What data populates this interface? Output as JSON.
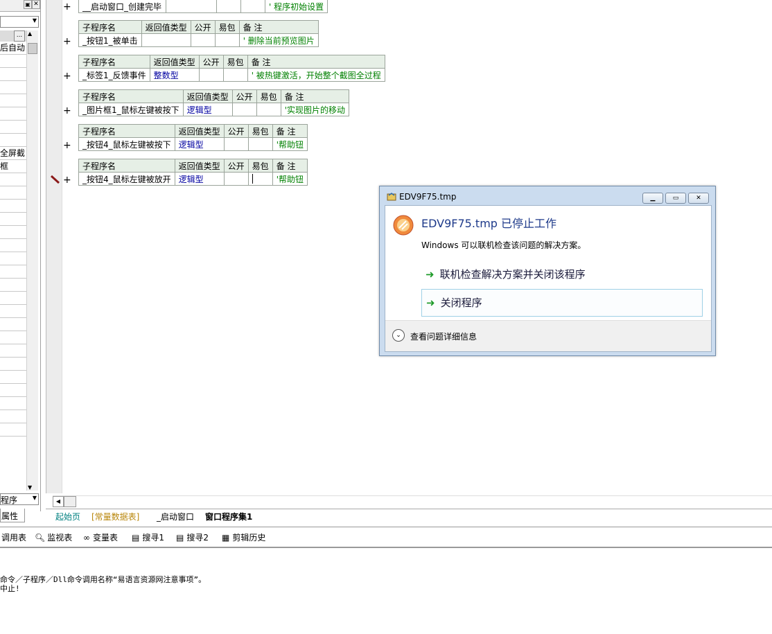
{
  "left_panel": {
    "partial_text_1": "后自动",
    "partial_text_2": "全屏截",
    "partial_text_3": "框",
    "bottom_dropdown": "程序",
    "properties_tab": "属性",
    "ellipsis": "..."
  },
  "code_tables": [
    {
      "name": "__启动窗口_创建完毕",
      "type": "",
      "public": "",
      "package": "",
      "remark": "' 程序初始设置",
      "header_visible": false
    },
    {
      "name": "_按钮1_被单击",
      "type": "",
      "public": "",
      "package": "",
      "remark": "' 删除当前预览图片",
      "header_visible": true
    },
    {
      "name": "_标签1_反馈事件",
      "type": "整数型",
      "public": "",
      "package": "",
      "remark": "' 被热键激活，开始整个截图全过程",
      "header_visible": true
    },
    {
      "name": "_图片框1_鼠标左键被按下",
      "type": "逻辑型",
      "public": "",
      "package": "",
      "remark": "'实现图片的移动",
      "header_visible": true
    },
    {
      "name": "_按钮4_鼠标左键被按下",
      "type": "逻辑型",
      "public": "",
      "package": "",
      "remark": "'帮助钮",
      "header_visible": true
    },
    {
      "name": "_按钮4_鼠标左键被放开",
      "type": "逻辑型",
      "public": "",
      "package": "",
      "remark": "'帮助钮",
      "header_visible": true
    }
  ],
  "table_headers": {
    "name": "子程序名",
    "type": "返回值类型",
    "public": "公开",
    "package": "易包",
    "remark": "备 注"
  },
  "plus_symbol": "+",
  "tabs": [
    {
      "label": "起始页",
      "color": "#008080"
    },
    {
      "label": "[常量数据表]",
      "color": "#b8860b"
    },
    {
      "label": "_启动窗口",
      "color": "#000000"
    },
    {
      "label": "窗口程序集1",
      "color": "#000000",
      "active": true
    }
  ],
  "bottom_toolbar": [
    {
      "label": "调用表",
      "icon": "list-icon"
    },
    {
      "label": "监视表",
      "icon": "magnifier-icon"
    },
    {
      "label": "变量表",
      "icon": "variables-icon"
    },
    {
      "label": "搜寻1",
      "icon": "search-doc-icon"
    },
    {
      "label": "搜寻2",
      "icon": "search-doc-icon"
    },
    {
      "label": "剪辑历史",
      "icon": "clipboard-icon"
    }
  ],
  "output_lines": [
    "命令／子程序／Dll命令调用名称“易语言资源网注意事项”。",
    "中止!"
  ],
  "dialog": {
    "title": "EDV9F75.tmp",
    "heading": "EDV9F75.tmp 已停止工作",
    "message": "Windows 可以联机检查该问题的解决方案。",
    "option_check": "联机检查解决方案并关闭该程序",
    "option_close": "关闭程序",
    "details": "查看问题详细信息"
  },
  "colors": {
    "accent_green": "#1f9b2a",
    "header_bg": "#e6efe6",
    "dialog_frame": "#cbdcef"
  }
}
